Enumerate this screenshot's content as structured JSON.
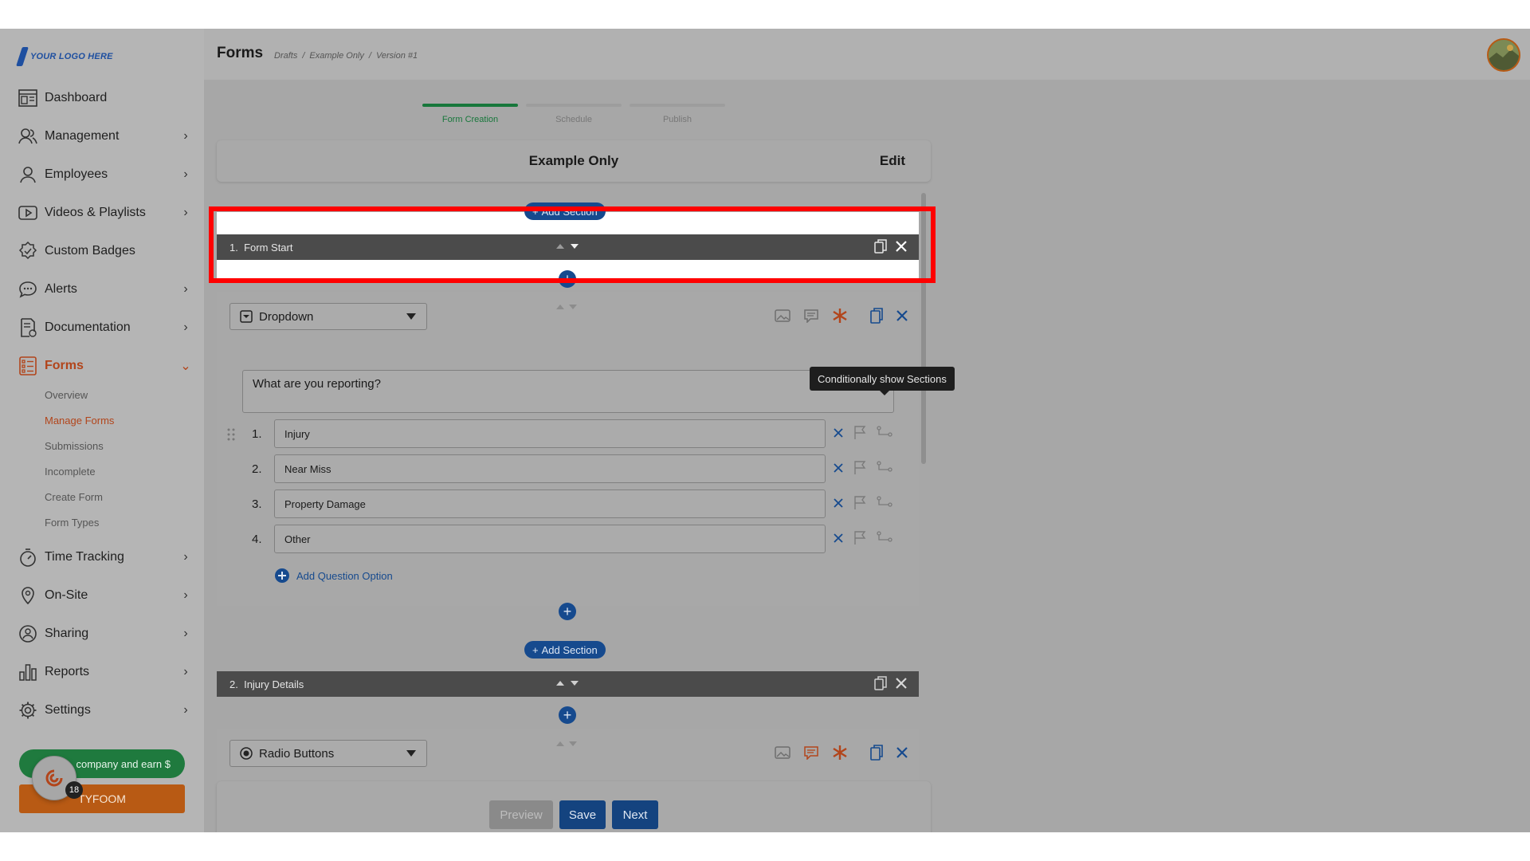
{
  "brand": {
    "logo_text": "YOUR LOGO HERE"
  },
  "header": {
    "title": "Forms",
    "breadcrumb": [
      "Drafts",
      "/",
      "Example Only",
      "/",
      "Version #1"
    ]
  },
  "sidebar": {
    "items": [
      {
        "label": "Dashboard",
        "icon": "dashboard-icon",
        "chevron": false
      },
      {
        "label": "Management",
        "icon": "users-icon",
        "chevron": true
      },
      {
        "label": "Employees",
        "icon": "user-icon",
        "chevron": true
      },
      {
        "label": "Videos & Playlists",
        "icon": "play-icon",
        "chevron": true
      },
      {
        "label": "Custom Badges",
        "icon": "badge-icon",
        "chevron": false
      },
      {
        "label": "Alerts",
        "icon": "chat-icon",
        "chevron": true
      },
      {
        "label": "Documentation",
        "icon": "document-icon",
        "chevron": true
      },
      {
        "label": "Forms",
        "icon": "list-icon",
        "chevron": true,
        "active": true
      },
      {
        "label": "Time Tracking",
        "icon": "stopwatch-icon",
        "chevron": true
      },
      {
        "label": "On-Site",
        "icon": "location-icon",
        "chevron": true
      },
      {
        "label": "Sharing",
        "icon": "share-icon",
        "chevron": true
      },
      {
        "label": "Reports",
        "icon": "bar-chart-icon",
        "chevron": true
      },
      {
        "label": "Settings",
        "icon": "gear-icon",
        "chevron": true
      }
    ],
    "forms_submenu": [
      "Overview",
      "Manage Forms",
      "Submissions",
      "Incomplete",
      "Create Form",
      "Form Types"
    ],
    "promo_label": "R... company and earn $",
    "brand_button": "TYFOOM",
    "help_badge_count": "18"
  },
  "stepper": {
    "steps": [
      "Form Creation",
      "Schedule",
      "Publish"
    ],
    "active_step": "Form Creation"
  },
  "form": {
    "name": "Example Only",
    "edit_label": "Edit",
    "add_section_label": "Add Section",
    "sections": [
      {
        "number": "1.",
        "title": "Form Start"
      },
      {
        "number": "2.",
        "title": "Injury Details"
      }
    ],
    "question1": {
      "type": "Dropdown",
      "text": "What are you reporting?",
      "options": [
        {
          "num": "1.",
          "value": "Injury"
        },
        {
          "num": "2.",
          "value": "Near Miss"
        },
        {
          "num": "3.",
          "value": "Property Damage"
        },
        {
          "num": "4.",
          "value": "Other"
        }
      ],
      "add_option_label": "Add Question Option"
    },
    "question2": {
      "type": "Radio Buttons"
    }
  },
  "tooltip": "Conditionally show Sections",
  "footer": {
    "preview": "Preview",
    "save": "Save",
    "next": "Next"
  },
  "colors": {
    "accent_blue": "#164a8e",
    "active_orange": "#b2451b",
    "step_green": "#17773b",
    "highlight_red": "#ff0000"
  }
}
